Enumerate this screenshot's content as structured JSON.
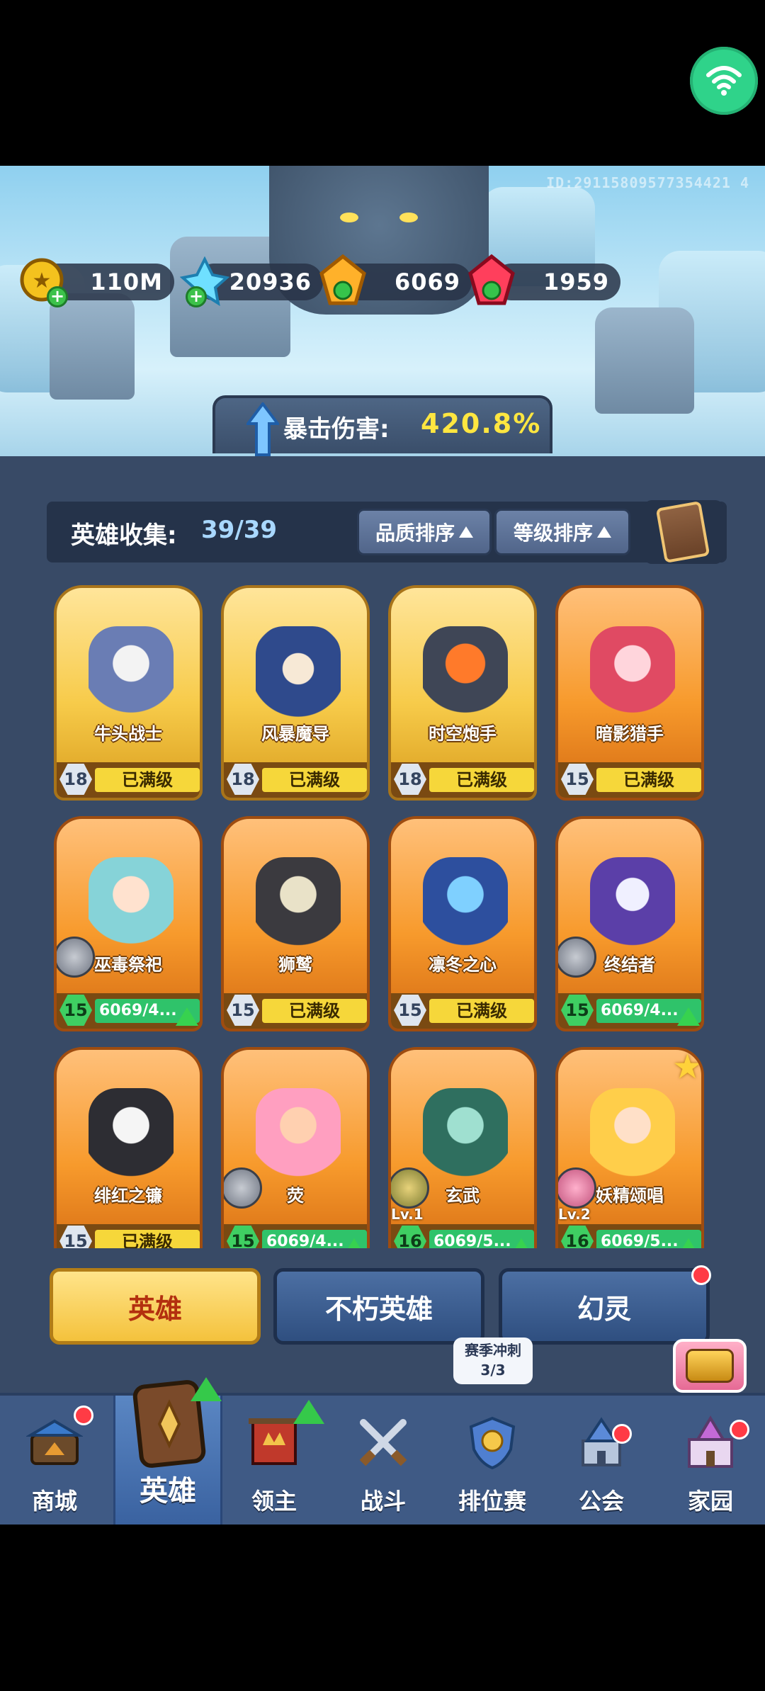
{
  "uid": "ID:29115809577354421 4",
  "currencies": [
    {
      "name": "gold-coin",
      "value": "110M"
    },
    {
      "name": "blue-crystal",
      "value": "20936"
    },
    {
      "name": "orange-gem",
      "value": "6069"
    },
    {
      "name": "red-gem",
      "value": "1959"
    }
  ],
  "crit": {
    "label": "暴击伤害:",
    "value": "420.8%"
  },
  "collection": {
    "label": "英雄收集:",
    "count": "39/39"
  },
  "sort": {
    "quality": "品质排序",
    "level": "等级排序"
  },
  "heroes": [
    {
      "name": "牛头战士",
      "level": "18",
      "status": "已满级",
      "rarity": "gold"
    },
    {
      "name": "风暴魔导",
      "level": "18",
      "status": "已满级",
      "rarity": "gold"
    },
    {
      "name": "时空炮手",
      "level": "18",
      "status": "已满级",
      "rarity": "gold"
    },
    {
      "name": "暗影猎手",
      "level": "15",
      "status": "已满级",
      "rarity": "orange"
    },
    {
      "name": "巫毒祭祀",
      "level": "15",
      "status": "6069/4...",
      "rarity": "orange"
    },
    {
      "name": "狮鹫",
      "level": "15",
      "status": "已满级",
      "rarity": "orange"
    },
    {
      "name": "凛冬之心",
      "level": "15",
      "status": "已满级",
      "rarity": "orange"
    },
    {
      "name": "终结者",
      "level": "15",
      "status": "6069/4...",
      "rarity": "orange"
    },
    {
      "name": "绯红之镰",
      "level": "15",
      "status": "已满级",
      "rarity": "orange"
    },
    {
      "name": "荧",
      "level": "15",
      "status": "6069/4...",
      "rarity": "orange"
    },
    {
      "name": "玄武",
      "level": "16",
      "status": "6069/5...",
      "rarity": "orange",
      "pet_level": "Lv.1"
    },
    {
      "name": "妖精颂唱",
      "level": "16",
      "status": "6069/5...",
      "rarity": "orange",
      "pet_level": "Lv.2"
    }
  ],
  "tabs": [
    "英雄",
    "不朽英雄",
    "幻灵"
  ],
  "season": {
    "line1": "赛季冲刺",
    "line2": "3/3"
  },
  "nav": [
    "商城",
    "英雄",
    "领主",
    "战斗",
    "排位赛",
    "公会",
    "家园"
  ],
  "colors": {
    "panel": "#384a66",
    "nav": "#3f5a85",
    "gold": "#f7cb4a",
    "orange": "#f79a2c",
    "accent": "#ffe640"
  }
}
